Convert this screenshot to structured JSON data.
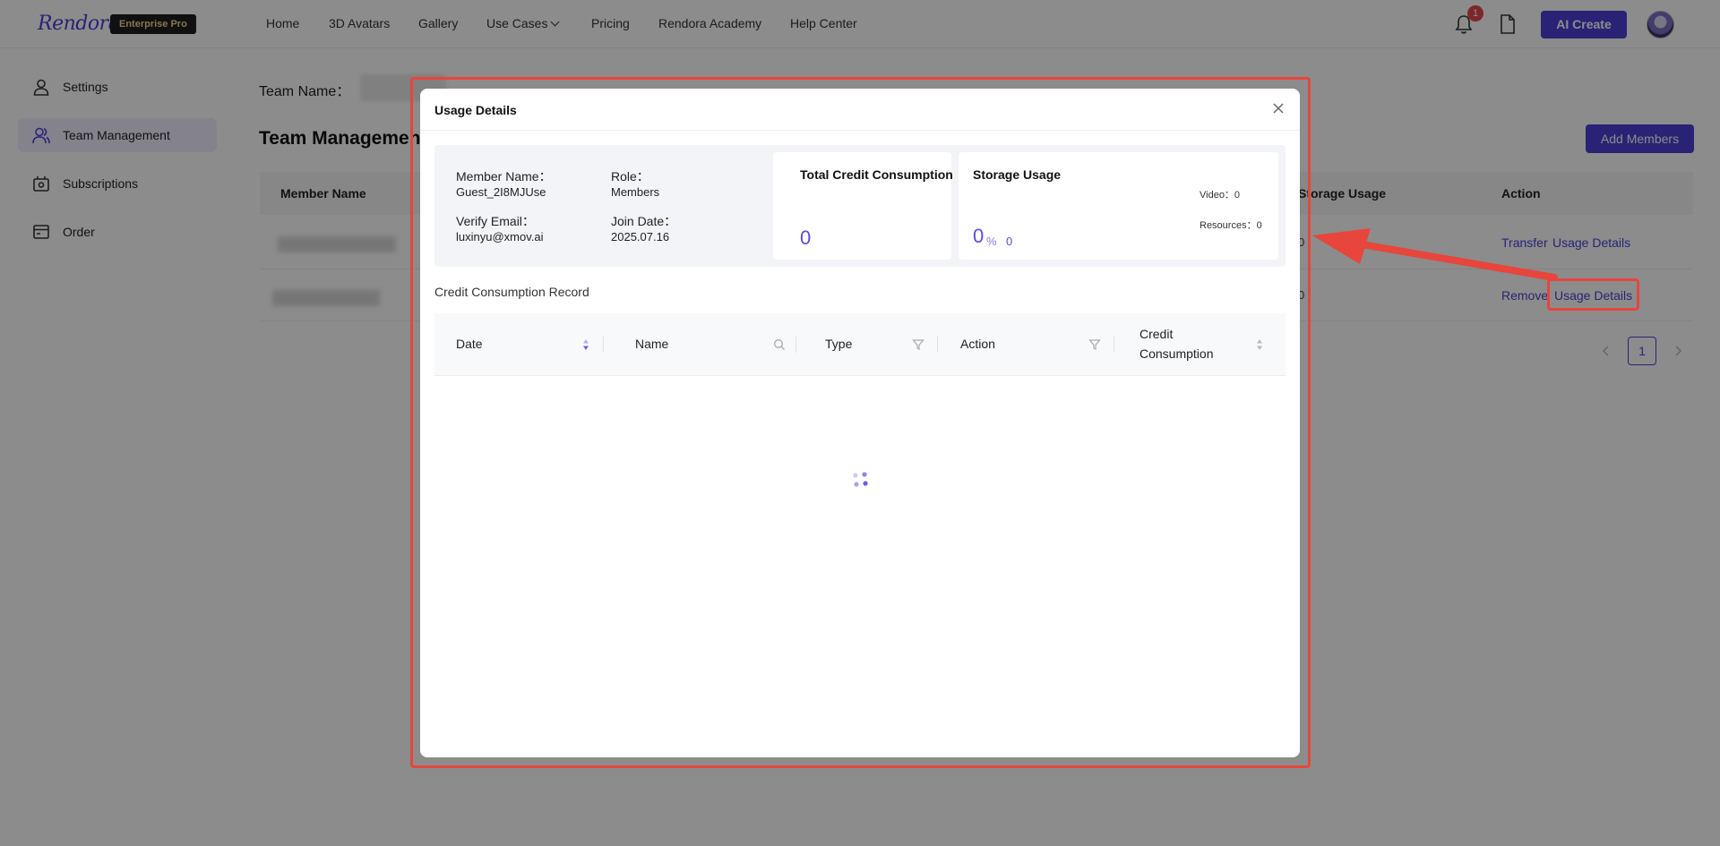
{
  "app": {
    "logo_text": "Rendora",
    "plan_badge": "Enterprise Pro",
    "nav": [
      "Home",
      "3D Avatars",
      "Gallery",
      "Use Cases",
      "Pricing",
      "Rendora Academy",
      "Help Center"
    ],
    "notification_count": "1",
    "ai_create_label": "AI Create",
    "accent_color": "#4c3fd6"
  },
  "sidebar": {
    "items": [
      {
        "label": "Settings",
        "icon": "user-icon"
      },
      {
        "label": "Team Management",
        "icon": "team-icon",
        "active": true
      },
      {
        "label": "Subscriptions",
        "icon": "subscriptions-icon"
      },
      {
        "label": "Order",
        "icon": "order-icon"
      }
    ]
  },
  "main": {
    "team_name_label": "Team Name：",
    "title": "Team Management",
    "add_members_label": "Add Members",
    "columns": [
      "Member Name",
      "Storage Usage",
      "Action"
    ],
    "rows": [
      {
        "storage": "0",
        "actions": [
          "Transfer",
          "Usage Details"
        ]
      },
      {
        "storage": "0",
        "actions": [
          "Remove",
          "Usage Details"
        ]
      }
    ],
    "page": "1"
  },
  "modal": {
    "title": "Usage Details",
    "member_name_label": "Member Name：",
    "member_name": "Guest_2I8MJUse",
    "role_label": "Role：",
    "role": "Members",
    "email_label": "Verify Email：",
    "email": "luxinyu@xmov.ai",
    "join_date_label": "Join Date：",
    "join_date": "2025.07.16",
    "credit_card_title": "Total Credit Consumption",
    "credit_value": "0",
    "storage_card_title": "Storage Usage",
    "storage_percent": "0",
    "storage_percent_unit": "%",
    "storage_amount": "0",
    "video_stat": "Video：0",
    "resources_stat": "Resources：0",
    "section_title": "Credit Consumption Record",
    "record_columns": [
      "Date",
      "Name",
      "Type",
      "Action",
      "Credit",
      "Consumption"
    ]
  }
}
